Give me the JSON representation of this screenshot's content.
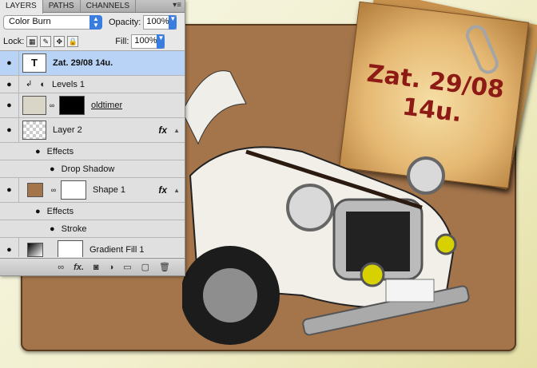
{
  "panel": {
    "tabs": [
      "LAYERS",
      "PATHS",
      "CHANNELS"
    ],
    "menu_icon": "panel-menu-icon",
    "blend_mode": "Color Burn",
    "opacity_label": "Opacity:",
    "opacity_value": "100%",
    "lock_label": "Lock:",
    "fill_label": "Fill:",
    "fill_value": "100%",
    "layers": [
      {
        "name": "Zat. 29/08 14u.",
        "type": "text",
        "selected": true,
        "thumb": "T"
      },
      {
        "name": "Levels 1",
        "type": "adjustment"
      },
      {
        "name": "oldtimer",
        "type": "image-with-mask"
      },
      {
        "name": "Layer 2",
        "type": "pixel",
        "fx": "fx"
      },
      {
        "name": "Effects",
        "type": "effects-header"
      },
      {
        "name": "Drop Shadow",
        "type": "effect"
      },
      {
        "name": "Shape 1",
        "type": "shape",
        "fx": "fx"
      },
      {
        "name": "Effects",
        "type": "effects-header"
      },
      {
        "name": "Stroke",
        "type": "effect"
      },
      {
        "name": "Gradient Fill 1",
        "type": "fill"
      }
    ]
  },
  "canvas": {
    "note_line1": "Zat. 29/08",
    "note_line2": "14u.",
    "card_color": "#a4754b",
    "text_color": "#8e1a15"
  }
}
